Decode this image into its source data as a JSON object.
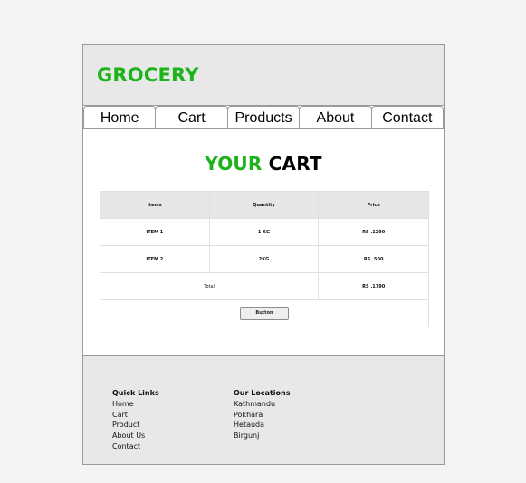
{
  "header": {
    "brand": "GROCERY"
  },
  "nav": {
    "items": [
      {
        "label": "Home"
      },
      {
        "label": "Cart"
      },
      {
        "label": "Products"
      },
      {
        "label": "About"
      },
      {
        "label": "Contact"
      }
    ]
  },
  "cart": {
    "title_first": "YOUR",
    "title_second": "CART",
    "columns": [
      "Items",
      "Quantity",
      "Price"
    ],
    "rows": [
      {
        "item": "ITEM 1",
        "quantity": "1 KG",
        "price": "RS .1290"
      },
      {
        "item": "ITEM 2",
        "quantity": "2KG",
        "price": "RS .500"
      }
    ],
    "total_label": "Total",
    "total_value": "RS .1790",
    "button_label": "Button"
  },
  "footer": {
    "quick_links": {
      "heading": "Quick Links",
      "links": [
        "Home",
        "Cart",
        "Product",
        "About Us",
        "Contact"
      ]
    },
    "locations": {
      "heading": "Our Locations",
      "links": [
        "Kathmandu",
        "Pokhara",
        "Hetauda",
        "Birgunj"
      ]
    }
  },
  "colors": {
    "brand_green": "#1db31a",
    "panel_gray": "#e8e8e8",
    "page_bg": "#f4f4f6",
    "border": "#9a9a9a"
  }
}
